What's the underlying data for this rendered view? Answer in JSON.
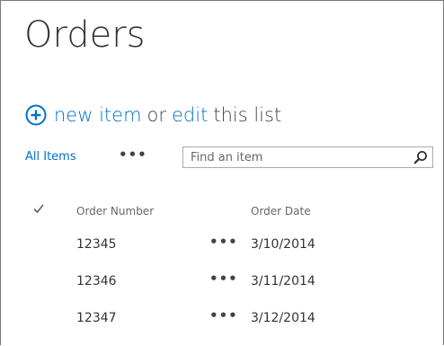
{
  "page": {
    "title": "Orders"
  },
  "actions": {
    "new_item": "new item",
    "or": "or",
    "edit": "edit",
    "this_list": "this list"
  },
  "views": {
    "all_items": "All Items",
    "more": "•••",
    "search_placeholder": "Find an item"
  },
  "list": {
    "columns": {
      "order_number": "Order Number",
      "order_date": "Order Date"
    },
    "row_menu": "•••",
    "rows": [
      {
        "order_number": "12345",
        "order_date": "3/10/2014"
      },
      {
        "order_number": "12346",
        "order_date": "3/11/2014"
      },
      {
        "order_number": "12347",
        "order_date": "3/12/2014"
      }
    ]
  },
  "colors": {
    "link": "#0072c6",
    "text": "#444444",
    "border": "#7a7a7a"
  },
  "icons": {
    "new": "plus-circle-icon",
    "search": "search-icon",
    "select_all": "check-icon"
  }
}
